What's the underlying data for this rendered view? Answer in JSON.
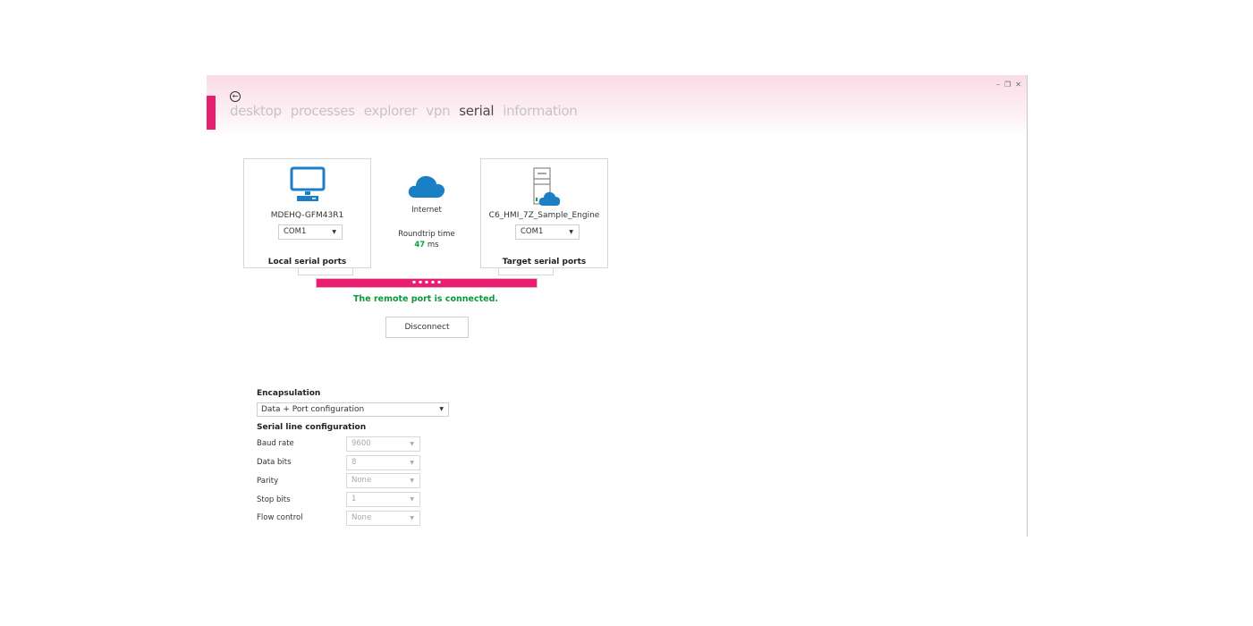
{
  "window": {
    "controls": {
      "minimize": "–",
      "restore": "❐",
      "close": "✕"
    },
    "accent_color": "#e5206f"
  },
  "nav": {
    "back_icon": "←",
    "items": [
      {
        "label": "desktop",
        "active": false
      },
      {
        "label": "processes",
        "active": false
      },
      {
        "label": "explorer",
        "active": false
      },
      {
        "label": "vpn",
        "active": false
      },
      {
        "label": "serial",
        "active": true
      },
      {
        "label": "information",
        "active": false
      }
    ]
  },
  "local": {
    "icon": "monitor-icon",
    "name": "MDEHQ-GFM43R1",
    "port": "COM1",
    "caption": "Local serial ports"
  },
  "internet": {
    "icon": "cloud-icon",
    "label": "Internet",
    "roundtrip_label": "Roundtrip time",
    "roundtrip_value": "47",
    "roundtrip_unit": "ms"
  },
  "target": {
    "icon": "server-cloud-icon",
    "name": "C6_HMI_7Z_Sample_Engine",
    "port": "COM1",
    "caption": "Target serial ports"
  },
  "connection": {
    "status": "The remote port is connected.",
    "status_color": "#0a9a3a",
    "bar_color": "#e91e73",
    "disconnect_label": "Disconnect"
  },
  "config": {
    "encapsulation_label": "Encapsulation",
    "encapsulation_value": "Data + Port configuration",
    "serial_line_label": "Serial line configuration",
    "rows": [
      {
        "label": "Baud rate",
        "value": "9600"
      },
      {
        "label": "Data bits",
        "value": "8"
      },
      {
        "label": "Parity",
        "value": "None"
      },
      {
        "label": "Stop bits",
        "value": "1"
      },
      {
        "label": "Flow control",
        "value": "None"
      }
    ]
  }
}
